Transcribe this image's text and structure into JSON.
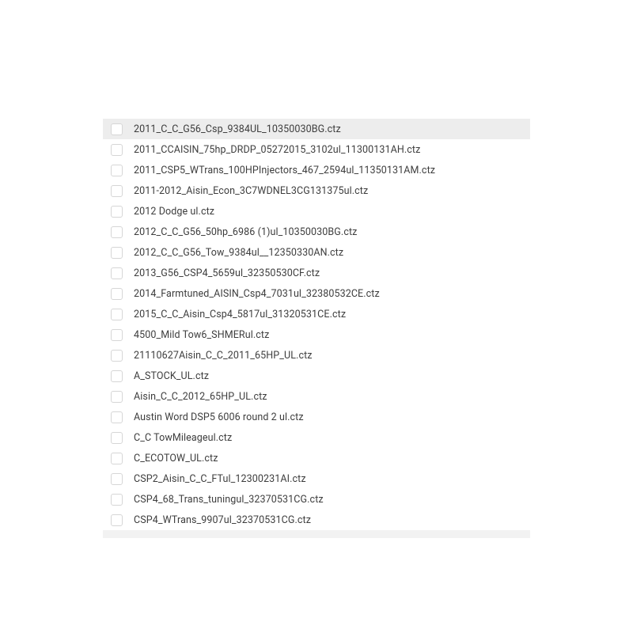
{
  "files": [
    {
      "name": "2011_C_C_G56_Csp_9384UL_10350030BG.ctz",
      "selected": true
    },
    {
      "name": "2011_CCAISIN_75hp_DRDP_05272015_3102ul_11300131AH.ctz",
      "selected": false
    },
    {
      "name": "2011_CSP5_WTrans_100HPInjectors_467_2594ul_11350131AM.ctz",
      "selected": false
    },
    {
      "name": "2011-2012_Aisin_Econ_3C7WDNEL3CG131375ul.ctz",
      "selected": false
    },
    {
      "name": "2012 Dodge ul.ctz",
      "selected": false
    },
    {
      "name": "2012_C_C_G56_50hp_6986 (1)ul_10350030BG.ctz",
      "selected": false
    },
    {
      "name": "2012_C_C_G56_Tow_9384ul__12350330AN.ctz",
      "selected": false
    },
    {
      "name": "2013_G56_CSP4_5659ul_32350530CF.ctz",
      "selected": false
    },
    {
      "name": "2014_Farmtuned_AISIN_Csp4_7031ul_32380532CE.ctz",
      "selected": false
    },
    {
      "name": "2015_C_C_Aisin_Csp4_5817ul_31320531CE.ctz",
      "selected": false
    },
    {
      "name": "4500_Mild Tow6_SHMERul.ctz",
      "selected": false
    },
    {
      "name": "21110627Aisin_C_C_2011_65HP_UL.ctz",
      "selected": false
    },
    {
      "name": "A_STOCK_UL.ctz",
      "selected": false
    },
    {
      "name": "Aisin_C_C_2012_65HP_UL.ctz",
      "selected": false
    },
    {
      "name": "Austin Word DSP5 6006 round 2 ul.ctz",
      "selected": false
    },
    {
      "name": "C_C TowMileageul.ctz",
      "selected": false
    },
    {
      "name": "C_ECOTOW_UL.ctz",
      "selected": false
    },
    {
      "name": "CSP2_Aisin_C_C_FTul_12300231AI.ctz",
      "selected": false
    },
    {
      "name": "CSP4_68_Trans_tuningul_32370531CG.ctz",
      "selected": false
    },
    {
      "name": "CSP4_WTrans_9907ul_32370531CG.ctz",
      "selected": false
    }
  ]
}
